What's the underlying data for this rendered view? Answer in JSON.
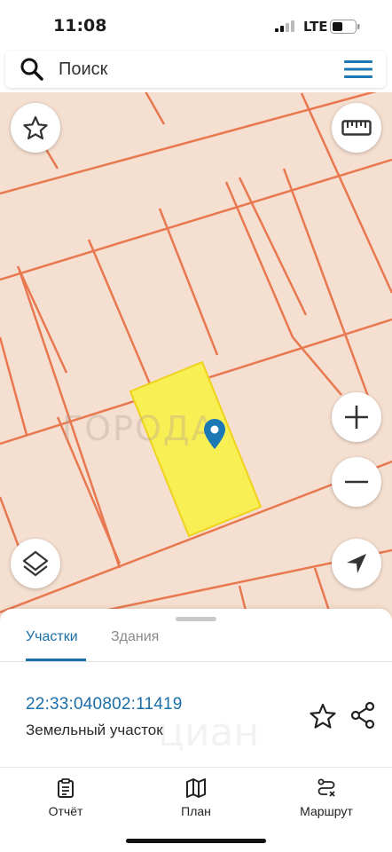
{
  "status_bar": {
    "time": "11:08",
    "network": "LTE"
  },
  "search": {
    "placeholder": "Поиск"
  },
  "map": {
    "watermark": "ГОРОДА",
    "selected_plot_color": "#f7ef54",
    "boundary_color": "#e8784f",
    "marker_color": "#1b78b5",
    "buttons": {
      "favorite": "star-icon",
      "measure": "ruler-icon",
      "zoom_in": "plus-icon",
      "zoom_out": "minus-icon",
      "layers": "layers-icon",
      "locate": "navigation-arrow-icon"
    }
  },
  "sheet": {
    "tabs": [
      {
        "label": "Участки",
        "active": true
      },
      {
        "label": "Здания",
        "active": false
      }
    ],
    "cadastral_number": "22:33:040802:11419",
    "plot_type": "Земельный участок",
    "watermark": "циан",
    "accent": "#1b6fa8"
  },
  "bottom_nav": [
    {
      "label": "Отчёт",
      "icon": "report-icon"
    },
    {
      "label": "План",
      "icon": "map-plan-icon"
    },
    {
      "label": "Маршрут",
      "icon": "route-icon"
    }
  ]
}
